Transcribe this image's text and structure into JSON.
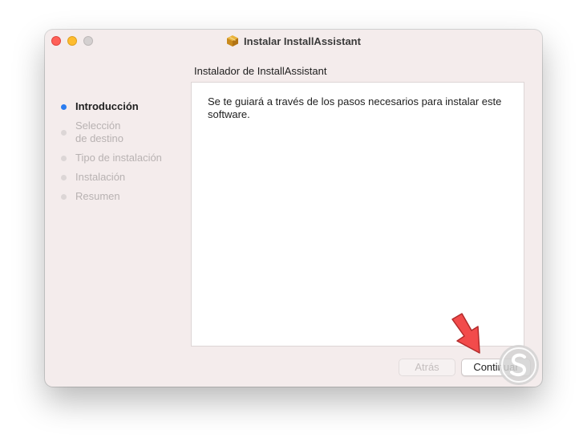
{
  "window": {
    "title": "Instalar InstallAssistant",
    "package_icon": "package-icon"
  },
  "pane": {
    "title": "Instalador de InstallAssistant",
    "body_text": "Se te guiará a través de los pasos necesarios para instalar este software."
  },
  "sidebar": {
    "steps": [
      {
        "label": "Introducción",
        "active": true
      },
      {
        "label_line1": "Selección",
        "label_line2": "de destino",
        "active": false
      },
      {
        "label": "Tipo de instalación",
        "active": false
      },
      {
        "label": "Instalación",
        "active": false
      },
      {
        "label": "Resumen",
        "active": false
      }
    ]
  },
  "buttons": {
    "back": "Atrás",
    "continue": "Continuar"
  },
  "colors": {
    "window_bg": "#f4ecec",
    "active_step_dot": "#2a7cf0",
    "annotation_arrow": "#f24b4b",
    "watermark": "#c9c9c9"
  }
}
